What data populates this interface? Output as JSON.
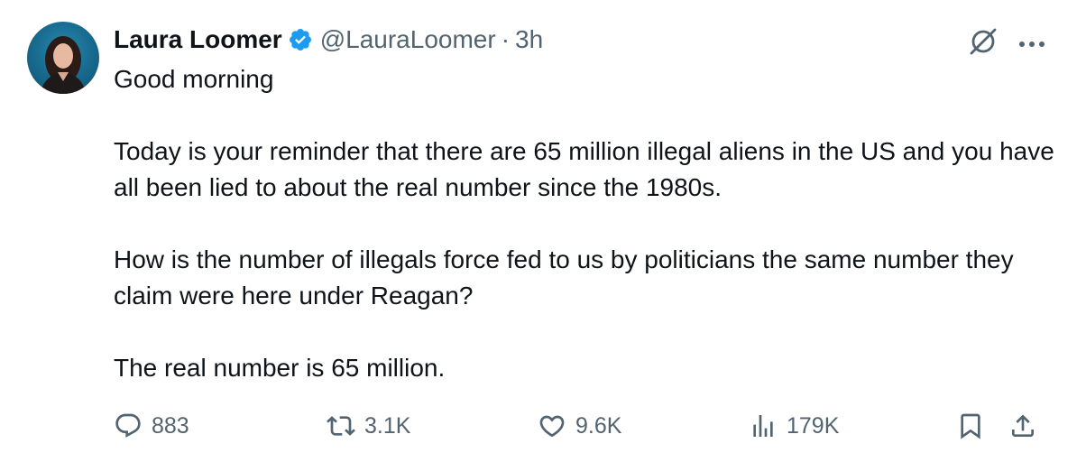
{
  "author": {
    "name": "Laura Loomer",
    "handle": "@LauraLoomer",
    "separator": "·",
    "time": "3h"
  },
  "post": {
    "line1": "Good morning",
    "line2": "Today is your reminder that there are 65 million illegal aliens in the US and you have all been lied to about the real number since the 1980s.",
    "line3": "How is the number of illegals force fed to us by politicians the same number they claim were here under Reagan?",
    "line4": "The real number is 65 million."
  },
  "actions": {
    "replies": "883",
    "reposts": "3.1K",
    "likes": "9.6K",
    "views": "179K"
  },
  "colors": {
    "text": "#0f1419",
    "secondary": "#536471",
    "verified": "#1d9bf0"
  },
  "icons": [
    "verified-badge-icon",
    "grok-icon",
    "more-icon",
    "reply-icon",
    "repost-icon",
    "like-icon",
    "views-icon",
    "bookmark-icon",
    "share-icon"
  ]
}
